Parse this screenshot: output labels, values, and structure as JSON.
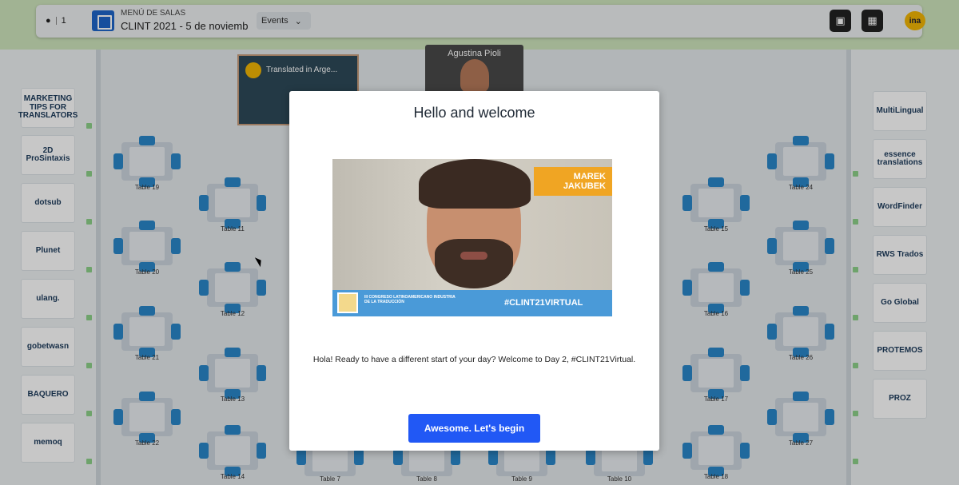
{
  "topbar": {
    "participants": "1",
    "room_menu_label": "MENÚ DE SALAS",
    "room_name": "CLINT 2021 - 5 de noviemb...",
    "events_label": "Events"
  },
  "stage": {
    "video_title": "Translated in Arge...",
    "speaker_name": "Agustina Pioli"
  },
  "left_sponsors": [
    "MARKETING TIPS FOR TRANSLATORS",
    "2D ProSintaxis",
    "dotsub",
    "Plunet",
    "ulang.",
    "gobetwasn",
    "BAQUERO",
    "memoq"
  ],
  "right_sponsors": [
    "MultiLingual",
    "essence translations",
    "WordFinder",
    "RWS Trados",
    "Go Global",
    "PROTEMOS",
    "PROZ"
  ],
  "tables": {
    "t19": "Table 19",
    "t20": "Table 20",
    "t21": "Table 21",
    "t22": "Table 22",
    "t11": "Table 11",
    "t12": "Table 12",
    "t13": "Table 13",
    "t14": "Table 14",
    "t15": "Table 15",
    "t16": "Table 16",
    "t17": "Table 17",
    "t18": "Table 18",
    "t24": "Table 24",
    "t25": "Table 25",
    "t26": "Table 26",
    "t27": "Table 27",
    "t7": "Table 7",
    "t8": "Table 8",
    "t9": "Table 9",
    "t10": "Table 10"
  },
  "modal": {
    "title": "Hello and welcome",
    "video_name_line1": "MAREK",
    "video_name_line2": "JAKUBEK",
    "video_congress": "III CONGRESO LATINOAMERICANO INDUSTRIA DE LA TRADUCCIÓN",
    "video_hashtag": "#CLINT21VIRTUAL",
    "message": "Hola! Ready to have a different start of your day? Welcome to Day 2, #CLINT21Virtual.",
    "button_label": "Awesome. Let's begin"
  },
  "colors": {
    "accent": "#2158f5",
    "chair": "#2a87c9",
    "grass": "#cfe6bd"
  }
}
